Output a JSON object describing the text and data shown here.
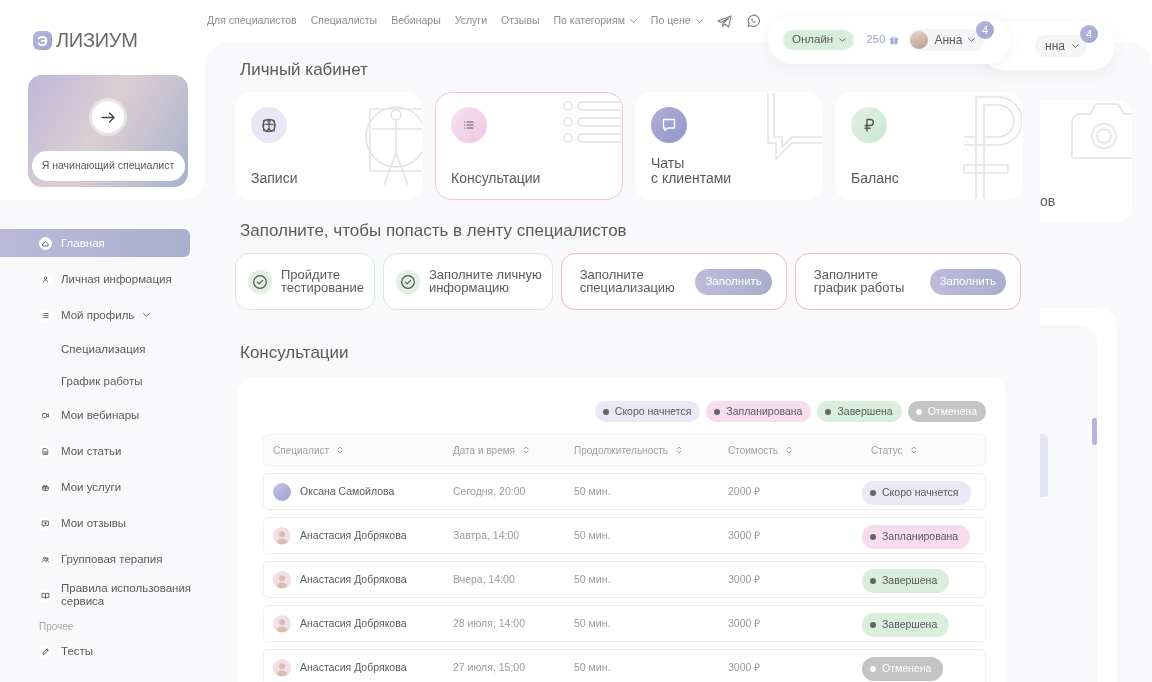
{
  "logo": {
    "mark": "Э",
    "text": "ЛИЗИУМ"
  },
  "promo": {
    "label": "Я начинающий специалист"
  },
  "nav": {
    "links": [
      {
        "label": "Для специалистов",
        "dropdown": false
      },
      {
        "label": "Специалисты",
        "dropdown": false
      },
      {
        "label": "Вебинары",
        "dropdown": false
      },
      {
        "label": "Услуги",
        "dropdown": false
      },
      {
        "label": "Отзывы",
        "dropdown": false
      },
      {
        "label": "По категориям",
        "dropdown": true
      },
      {
        "label": "По цене",
        "dropdown": true
      }
    ]
  },
  "header": {
    "status": "Онлайн",
    "points": "250",
    "user": "Анна",
    "badge": "4"
  },
  "sidebar": {
    "items": [
      {
        "label": "Главная",
        "selected": true
      },
      {
        "label": "Личная информация",
        "selected": false
      },
      {
        "label": "Мой профиль",
        "selected": false,
        "expanded": true,
        "children": [
          {
            "label": "Специализация",
            "selected": false
          },
          {
            "label": "График работы",
            "selected": false
          }
        ]
      },
      {
        "label": "Мои вебинары",
        "selected": false
      },
      {
        "label": "Мои статьи",
        "selected": false
      },
      {
        "label": "Мои услуги",
        "selected": false
      },
      {
        "label": "Мои отзывы",
        "selected": false
      },
      {
        "label": "Групповая терапия",
        "selected": false
      },
      {
        "label": "Правила использования сервиса",
        "selected": false
      }
    ],
    "sections": [
      {
        "title": "Прочее",
        "items": [
          {
            "label": "Тесты",
            "selected": false
          }
        ]
      }
    ]
  },
  "page_title": "Личный кабинет",
  "cards": [
    {
      "label": "Записи",
      "selected": false
    },
    {
      "label": "Консультации",
      "selected": true
    },
    {
      "label": "Чаты\nс клиентами",
      "selected": false
    },
    {
      "label": "Баланс",
      "selected": false
    }
  ],
  "onboarding": {
    "title": "Заполните, чтобы попасть в ленту специалистов",
    "steps": [
      {
        "label": "Пройдите\nтестирование",
        "done": true
      },
      {
        "label": "Заполните личную\nинформацию",
        "done": true
      },
      {
        "label": "Заполните\nспециализацию",
        "done": false,
        "button": "Заполнить"
      },
      {
        "label": "Заполните\nграфик работы",
        "done": false,
        "button": "Заполнить"
      }
    ]
  },
  "consultations": {
    "title": "Консультации",
    "legend": [
      {
        "label": "Скоро начнется",
        "color": "#e8e8f6"
      },
      {
        "label": "Запланирована",
        "color": "#f6dcee"
      },
      {
        "label": "Завершена",
        "color": "#d9eedb"
      },
      {
        "label": "Отменена",
        "color": "#c4c4c4"
      }
    ],
    "columns": [
      "Специалист",
      "Дата и время",
      "Продолжительность",
      "Стоимость",
      "Статус"
    ],
    "rows": [
      {
        "specialist": "Оксана Самойлова",
        "avatar": {
          "kind": "plain"
        },
        "date": "Сегодня, 20:00",
        "duration": "50 мин.",
        "price": "2000 ₽",
        "status": "Скоро начнется",
        "color": "#e8e8f6"
      },
      {
        "specialist": "Анастасия Добрякова",
        "avatar": {
          "kind": "photo"
        },
        "date": "Завтра, 14:00",
        "duration": "50 мин.",
        "price": "3000 ₽",
        "status": "Запланирована",
        "color": "#f6dcee"
      },
      {
        "specialist": "Анастасия Добрякова",
        "avatar": {
          "kind": "photo"
        },
        "date": "Вчера, 14:00",
        "duration": "50 мин.",
        "price": "3000 ₽",
        "status": "Завершена",
        "color": "#d9eedb"
      },
      {
        "specialist": "Анастасия Добрякова",
        "avatar": {
          "kind": "photo"
        },
        "date": "28 июля, 14:00",
        "duration": "50 мин.",
        "price": "3000 ₽",
        "status": "Завершена",
        "color": "#d9eedb"
      },
      {
        "specialist": "Анастасия Добрякова",
        "avatar": {
          "kind": "photo"
        },
        "date": "27 июля, 15:00",
        "duration": "50 мин.",
        "price": "3000 ₽",
        "status": "Отменена",
        "color": "#c4c4c4"
      }
    ]
  },
  "background_layer": {
    "user": "нна",
    "badge": "4",
    "card_label": "ов"
  }
}
